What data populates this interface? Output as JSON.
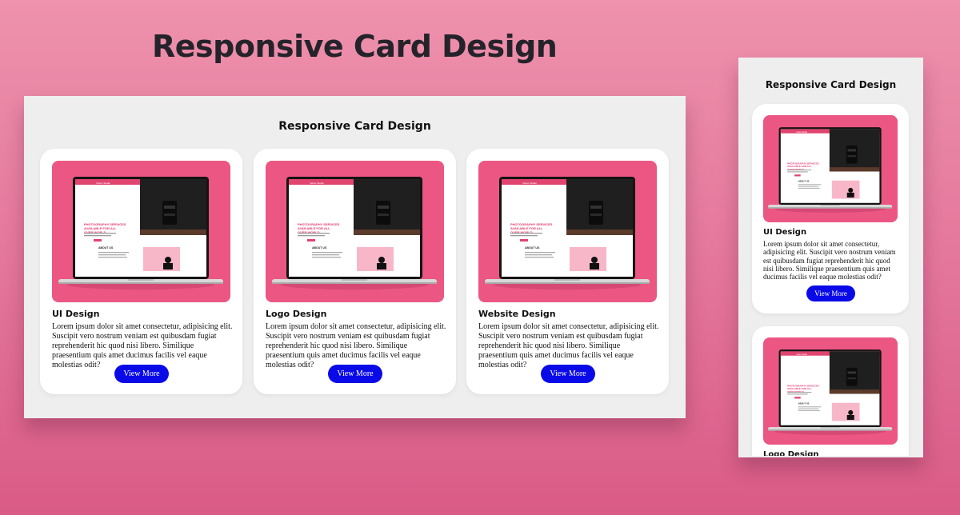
{
  "hero": {
    "title": "Responsive Card Design"
  },
  "desktop": {
    "title": "Responsive Card Design",
    "cards": [
      {
        "title": "UI Design",
        "text": "Lorem ipsum dolor sit amet consectetur, adipisicing elit. Suscipit vero nostrum veniam est quibusdam fugiat reprehenderit hic quod nisi libero. Similique praesentium quis amet ducimus facilis vel eaque molestias odit?",
        "button": "View More"
      },
      {
        "title": "Logo Design",
        "text": "Lorem ipsum dolor sit amet consectetur, adipisicing elit. Suscipit vero nostrum veniam est quibusdam fugiat reprehenderit hic quod nisi libero. Similique praesentium quis amet ducimus facilis vel eaque molestias odit?",
        "button": "View More"
      },
      {
        "title": "Website Design",
        "text": "Lorem ipsum dolor sit amet consectetur, adipisicing elit. Suscipit vero nostrum veniam est quibusdam fugiat reprehenderit hic quod nisi libero. Similique praesentium quis amet ducimus facilis vel eaque molestias odit?",
        "button": "View More"
      }
    ]
  },
  "mobile": {
    "title": "Responsive Card Design",
    "cards": [
      {
        "title": "UI Design",
        "text": "Lorem ipsum dolor sit amet consectetur, adipisicing elit. Suscipit vero nostrum veniam est quibusdam fugiat reprehenderit hic quod nisi libero. Similique praesentium quis amet ducimus facilis vel eaque molestias odit?",
        "button": "View More"
      },
      {
        "title": "Logo Design"
      }
    ]
  },
  "mockup_screen": {
    "brand": "Vertex Studio",
    "headline_lines": [
      "PHOTOGRAPHY SERVICES",
      "AVAILABLE FOR ALL",
      "OVER WORLD"
    ],
    "section": "ABOUT US"
  },
  "colors": {
    "background_top": "#ee92ad",
    "background_bottom": "#d95b86",
    "panel": "#eeeeee",
    "card": "#ffffff",
    "thumbnail": "#ec5683",
    "button": "#0a0ae8"
  }
}
